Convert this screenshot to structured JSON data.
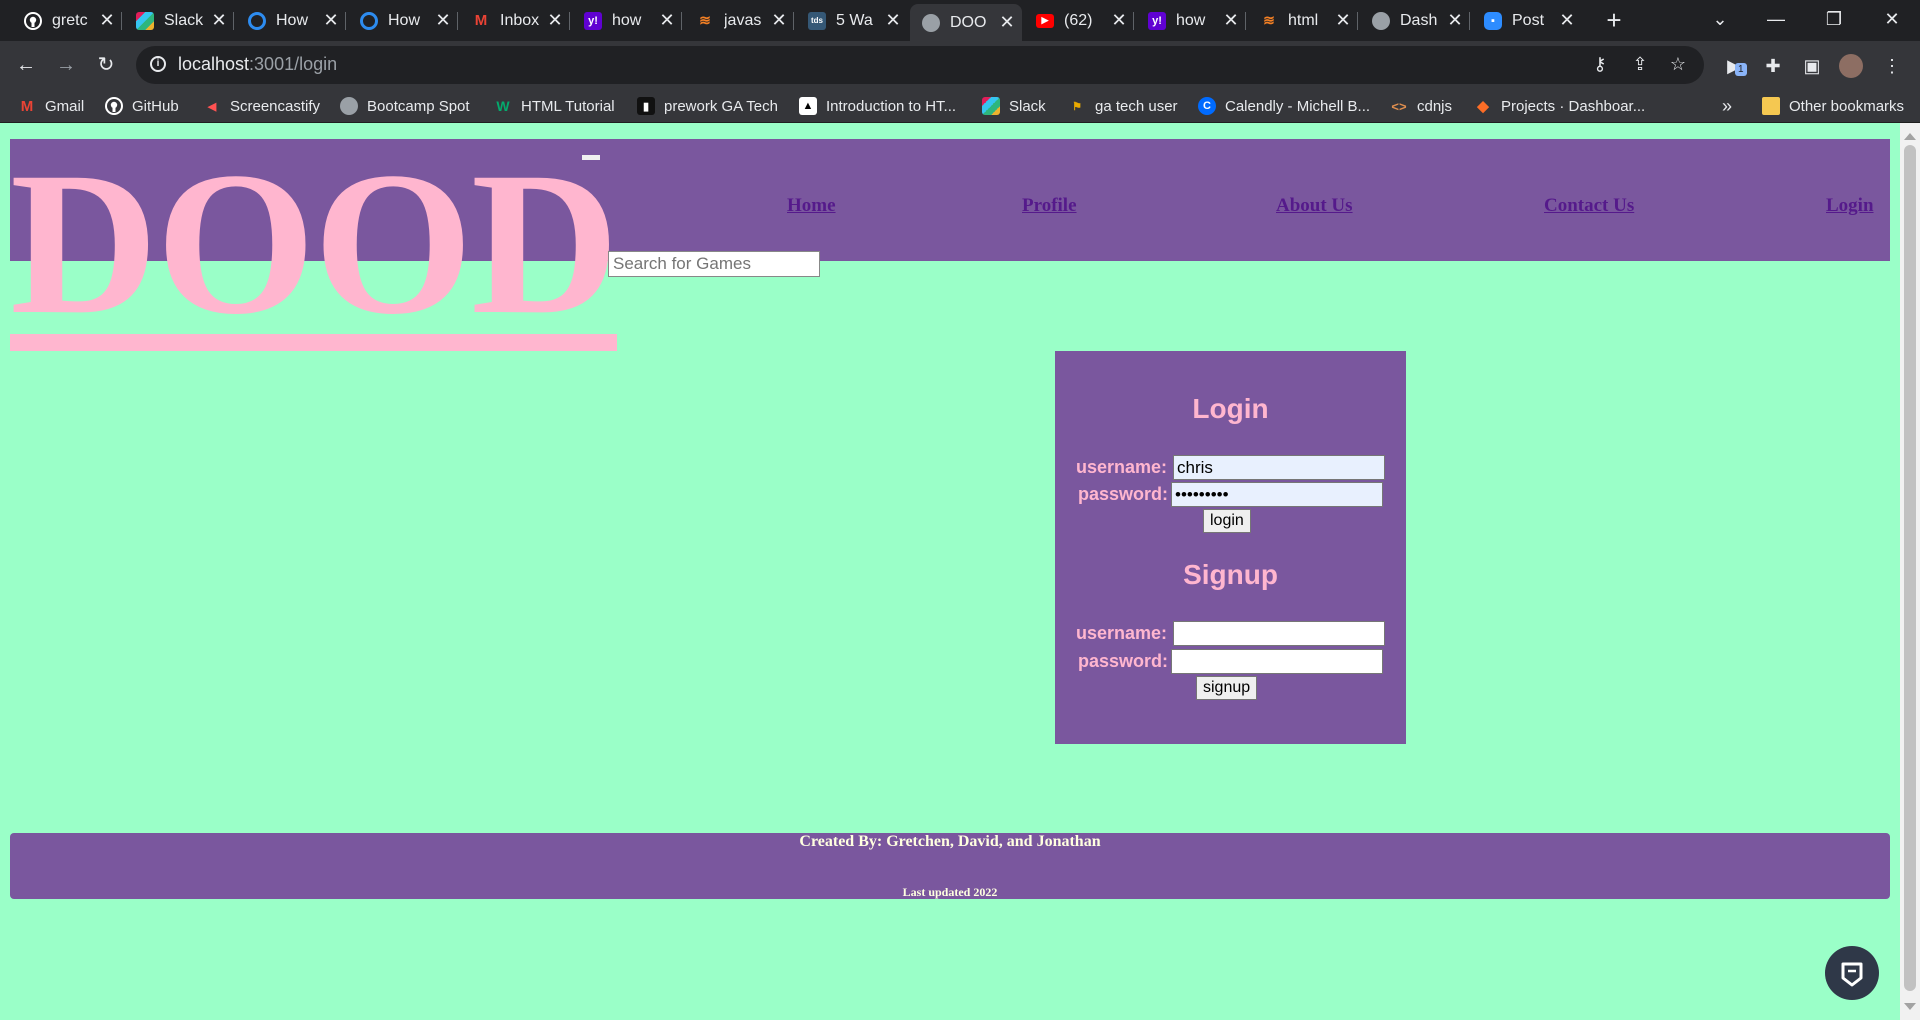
{
  "browser": {
    "tabs": [
      {
        "title": "gretc",
        "icon": "github-icon"
      },
      {
        "title": "Slack",
        "icon": "slack-icon"
      },
      {
        "title": "How",
        "icon": "loop-icon"
      },
      {
        "title": "How",
        "icon": "loop-icon"
      },
      {
        "title": "Inbox",
        "icon": "gmail-icon"
      },
      {
        "title": "how",
        "icon": "yahoo-icon"
      },
      {
        "title": "javas",
        "icon": "stackoverflow-icon"
      },
      {
        "title": "5 Wa",
        "icon": "tds-icon"
      },
      {
        "title": "DOO",
        "icon": "globe-icon"
      },
      {
        "title": "(62)",
        "icon": "youtube-icon"
      },
      {
        "title": "how",
        "icon": "yahoo-icon"
      },
      {
        "title": "html",
        "icon": "stackoverflow-icon"
      },
      {
        "title": "Dash",
        "icon": "globe-icon"
      },
      {
        "title": "Post",
        "icon": "zoom-icon"
      }
    ],
    "active_tab_index": 8,
    "url": {
      "host": "localhost",
      "path": ":3001/login"
    },
    "bookmarks": [
      {
        "label": "Gmail",
        "icon": "gmail-icon"
      },
      {
        "label": "GitHub",
        "icon": "github-icon"
      },
      {
        "label": "Screencastify",
        "icon": "screencastify-icon"
      },
      {
        "label": "Bootcamp Spot",
        "icon": "globe-icon"
      },
      {
        "label": "HTML Tutorial",
        "icon": "w3schools-icon"
      },
      {
        "label": "prework GA Tech",
        "icon": "notebook-icon"
      },
      {
        "label": "Introduction to HT...",
        "icon": "cap-icon"
      },
      {
        "label": "Slack",
        "icon": "slack-icon"
      },
      {
        "label": "ga tech user",
        "icon": "ga-tech-icon"
      },
      {
        "label": "Calendly - Michell B...",
        "icon": "calendly-icon"
      },
      {
        "label": "cdnjs",
        "icon": "code-icon"
      },
      {
        "label": "Projects · Dashboar...",
        "icon": "gitlab-icon"
      }
    ],
    "bookmarks_overflow": "»",
    "other_bookmarks": "Other bookmarks",
    "extension_badge": "1"
  },
  "site": {
    "brand": "DOOD",
    "search": {
      "placeholder": "Search for Games"
    },
    "nav": [
      {
        "label": "Home"
      },
      {
        "label": "Profile"
      },
      {
        "label": "About Us"
      },
      {
        "label": "Contact Us"
      },
      {
        "label": "Login"
      }
    ],
    "login": {
      "title": "Login",
      "username_label": "username:",
      "password_label": "password:",
      "username_value": "chris",
      "password_value": "•••••••••",
      "button": "login"
    },
    "signup": {
      "title": "Signup",
      "username_label": "username:",
      "password_label": "password:",
      "username_value": "",
      "password_value": "",
      "button": "signup"
    },
    "footer": {
      "credit": "Created By: Gretchen, David, and Jonathan",
      "updated": "Last updated 2022"
    }
  },
  "colors": {
    "page_bg": "#9affc8",
    "header_bg": "#7a579e",
    "brand_pink": "#ffb6cf",
    "link": "#551a8b",
    "footer_text": "#ffffe0"
  }
}
